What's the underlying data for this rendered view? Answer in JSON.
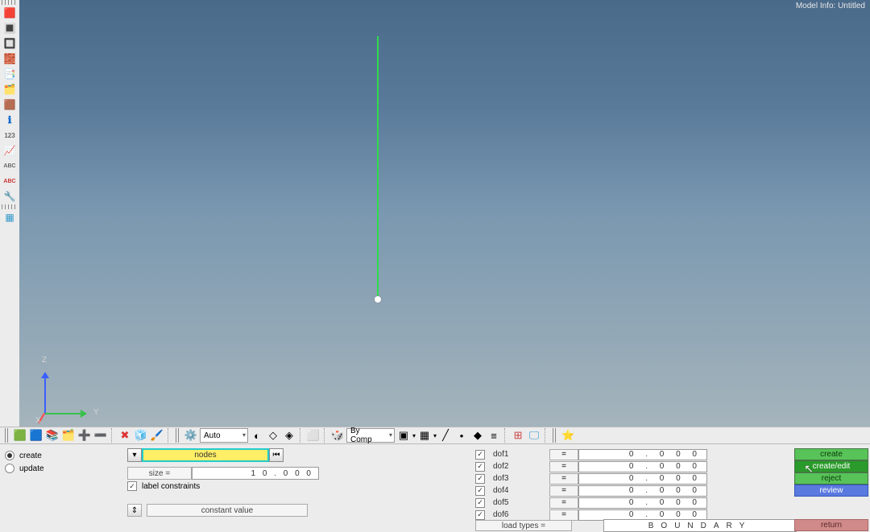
{
  "model_info": "Model Info: Untitled",
  "axes": {
    "x": "X",
    "y": "Y",
    "z": "Z"
  },
  "toolbar": {
    "auto": "Auto",
    "bycomp": "By Comp"
  },
  "panel": {
    "radios": {
      "create": "create",
      "update": "update"
    },
    "nodes": "nodes",
    "size_label": "size =",
    "size_value": "1 0 . 0 0 0",
    "label_constraints": "label constraints",
    "constant_value": "constant value",
    "dofs": [
      {
        "label": "dof1",
        "val": "0 . 0 0 0"
      },
      {
        "label": "dof2",
        "val": "0 . 0 0 0"
      },
      {
        "label": "dof3",
        "val": "0 . 0 0 0"
      },
      {
        "label": "dof4",
        "val": "0 . 0 0 0"
      },
      {
        "label": "dof5",
        "val": "0 . 0 0 0"
      },
      {
        "label": "dof6",
        "val": "0 . 0 0 0"
      }
    ],
    "load_types": "load types =",
    "boundary": "BOUNDARY",
    "buttons": {
      "create": "create",
      "create_edit": "create/edit",
      "reject": "reject",
      "review": "review",
      "return": "return"
    }
  }
}
